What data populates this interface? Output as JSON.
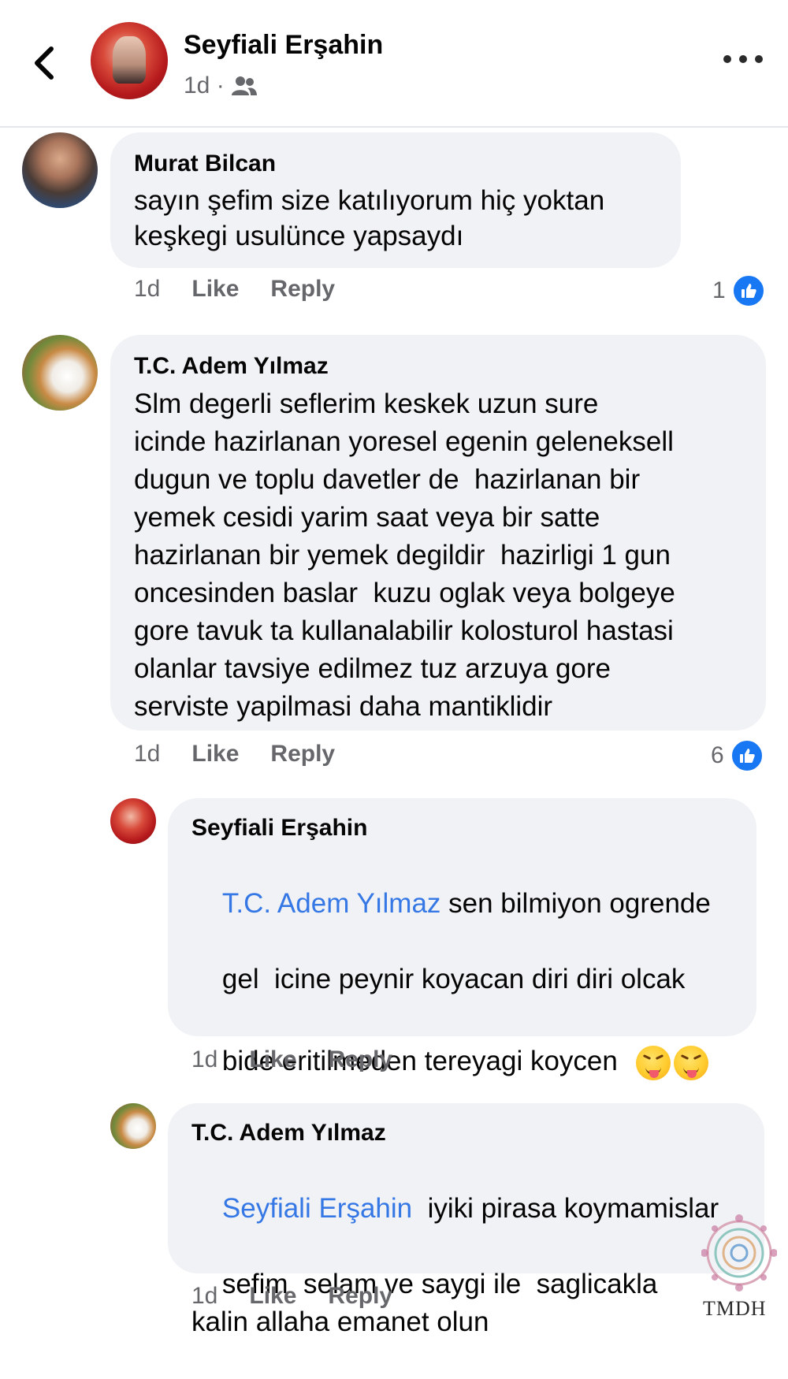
{
  "header": {
    "name": "Seyfiali Erşahin",
    "time": "1d ·",
    "audience_icon": "friends-icon",
    "back_icon": "chevron-left-icon",
    "more_icon": "more-horizontal-icon"
  },
  "comments": [
    {
      "author": "Murat Bilcan",
      "text": "sayın şefim size katılıyorum hiç yoktan\nkeşkegi usulünce yapsaydı",
      "time": "1d",
      "like_label": "Like",
      "reply_label": "Reply",
      "reaction_count": "1"
    },
    {
      "author": "T.C. Adem Yılmaz",
      "text": "Slm degerli seflerim keskek uzun sure\nicinde hazirlanan yoresel egenin geleneksell\ndugun ve toplu davetler de  hazirlanan bir\nyemek cesidi yarim saat veya bir satte\nhazirlanan bir yemek degildir  hazirligi 1 gun\noncesinden baslar  kuzu oglak veya bolgeye\ngore tavuk ta kullanalabilir kolosturol hastasi\nolanlar tavsiye edilmez tuz arzuya gore\nserviste yapilmasi daha mantiklidir",
      "time": "1d",
      "like_label": "Like",
      "reply_label": "Reply",
      "reaction_count": "6"
    }
  ],
  "replies": [
    {
      "author": "Seyfiali Erşahin",
      "mention": "T.C. Adem Yılmaz",
      "text_line1": " sen bilmiyon ogrende",
      "text_line2": "gel  icine peynir koyacan diri diri olcak",
      "text_line3": "bide eritilmeden tereyagi koycen",
      "emoji": "squinting-tongue-emoji",
      "time": "1d",
      "like_label": "Like",
      "reply_label": "Reply"
    },
    {
      "author": "T.C. Adem Yılmaz",
      "mention": "Seyfiali Erşahin",
      "text_line1": "  iyiki pirasa koymamislar",
      "text_rest": "sefim  selam ve saygi ile  saglicakla\nkalin allaha emanet olun",
      "time": "1d",
      "like_label": "Like",
      "reply_label": "Reply"
    }
  ],
  "watermark": {
    "text": "TMDH"
  },
  "colors": {
    "bubble": "#f0f2f5",
    "mention": "#3578e5",
    "like_badge": "#1877f2",
    "meta": "#65676b"
  }
}
